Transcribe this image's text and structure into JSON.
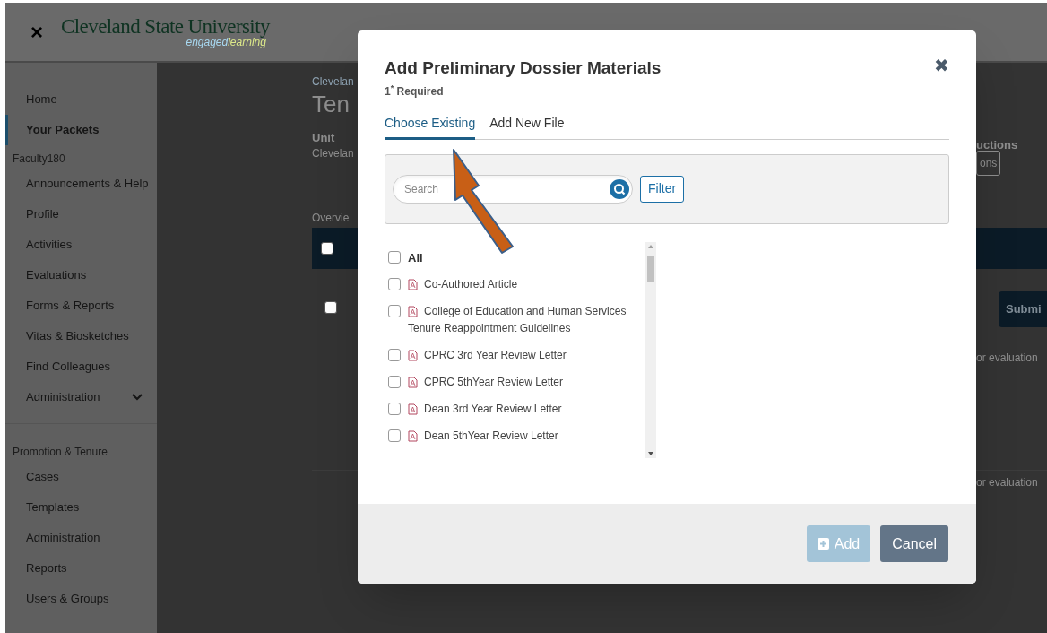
{
  "header": {
    "close": "×",
    "logo_title": "Cleveland State University",
    "logo_tagline_a": "engaged",
    "logo_tagline_b": "learning"
  },
  "sidebar": {
    "sections": [
      {
        "items": [
          {
            "label": "Home",
            "selected": false
          },
          {
            "label": "Your Packets",
            "selected": true
          }
        ]
      },
      {
        "heading": "Faculty180",
        "items": [
          {
            "label": "Announcements & Help",
            "selected": false
          },
          {
            "label": "Profile",
            "selected": false
          },
          {
            "label": "Activities",
            "selected": false
          },
          {
            "label": "Evaluations",
            "selected": false
          },
          {
            "label": "Forms & Reports",
            "selected": false
          },
          {
            "label": "Vitas & Biosketches",
            "selected": false
          },
          {
            "label": "Find Colleagues",
            "selected": false
          },
          {
            "label": "Administration",
            "selected": false,
            "expandable": true
          }
        ]
      },
      {
        "heading": "Promotion & Tenure",
        "items": [
          {
            "label": "Cases",
            "selected": false
          },
          {
            "label": "Templates",
            "selected": false
          },
          {
            "label": "Administration",
            "selected": false
          },
          {
            "label": "Reports",
            "selected": false
          },
          {
            "label": "Users & Groups",
            "selected": false
          }
        ]
      }
    ]
  },
  "background_page": {
    "breadcrumb": "Clevelan",
    "title": "Ten",
    "unit_label": "Unit",
    "unit_value": "Clevelan",
    "overview": "Overvie",
    "header_checkbox": {
      "checked": false
    },
    "row_checkbox": {
      "checked": false
    },
    "instructions_label": "uctions",
    "instructions_button": "ons",
    "submit_button": "Submi",
    "note_1": "or evaluation",
    "note_2": "or evaluation"
  },
  "dialog": {
    "title": "Add Preliminary Dossier Materials",
    "required": "1$^{*}$ Required",
    "close": "✖",
    "tabs": [
      {
        "label": "Choose Existing",
        "selected": true
      },
      {
        "label": "Add New File",
        "selected": false
      }
    ],
    "search": {
      "placeholder": "Search"
    },
    "filter_button": "Filter",
    "select_all": {
      "label": "All",
      "checked": false
    },
    "files": [
      {
        "name": "Co-Authored Article",
        "checked": false
      },
      {
        "name": "College of Education and Human Services Tenure Reappointment Guidelines",
        "checked": false
      },
      {
        "name": "CPRC 3rd Year Review Letter",
        "checked": false
      },
      {
        "name": "CPRC 5thYear Review Letter",
        "checked": false
      },
      {
        "name": "Dean 3rd Year Review Letter",
        "checked": false
      },
      {
        "name": "Dean 5thYear Review Letter",
        "checked": false
      }
    ],
    "add_button": {
      "label": "Add",
      "disabled": true
    },
    "cancel_button": "Cancel"
  }
}
